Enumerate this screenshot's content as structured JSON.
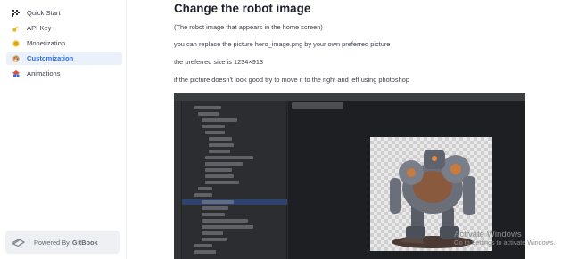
{
  "sidebar": {
    "items": [
      {
        "label": "Quick Start",
        "icon": "checkered-flag-icon",
        "active": false
      },
      {
        "label": "API Key",
        "icon": "key-icon",
        "active": false
      },
      {
        "label": "Monetization",
        "icon": "coin-icon",
        "active": false
      },
      {
        "label": "Customization",
        "icon": "palette-icon",
        "active": true
      },
      {
        "label": "Animations",
        "icon": "shapes-icon",
        "active": false
      }
    ],
    "gitbook": {
      "prefix": "Powered By",
      "brand": "GitBook"
    }
  },
  "content": {
    "title": "Change the robot image",
    "paragraphs": [
      "(The robot image that appears in the home screen)",
      "you can replace the picture hero_image.png by your own preferred picture",
      "the preferred size is 1234×913",
      "if the picture doesn't look good try to move it to the right and left using photoshop"
    ]
  },
  "watermark": {
    "title": "Activate Windows",
    "subtitle": "Go to Settings to activate Windows."
  },
  "colors": {
    "accent": "#2f6fde",
    "active_bg": "#eaf1fb"
  }
}
